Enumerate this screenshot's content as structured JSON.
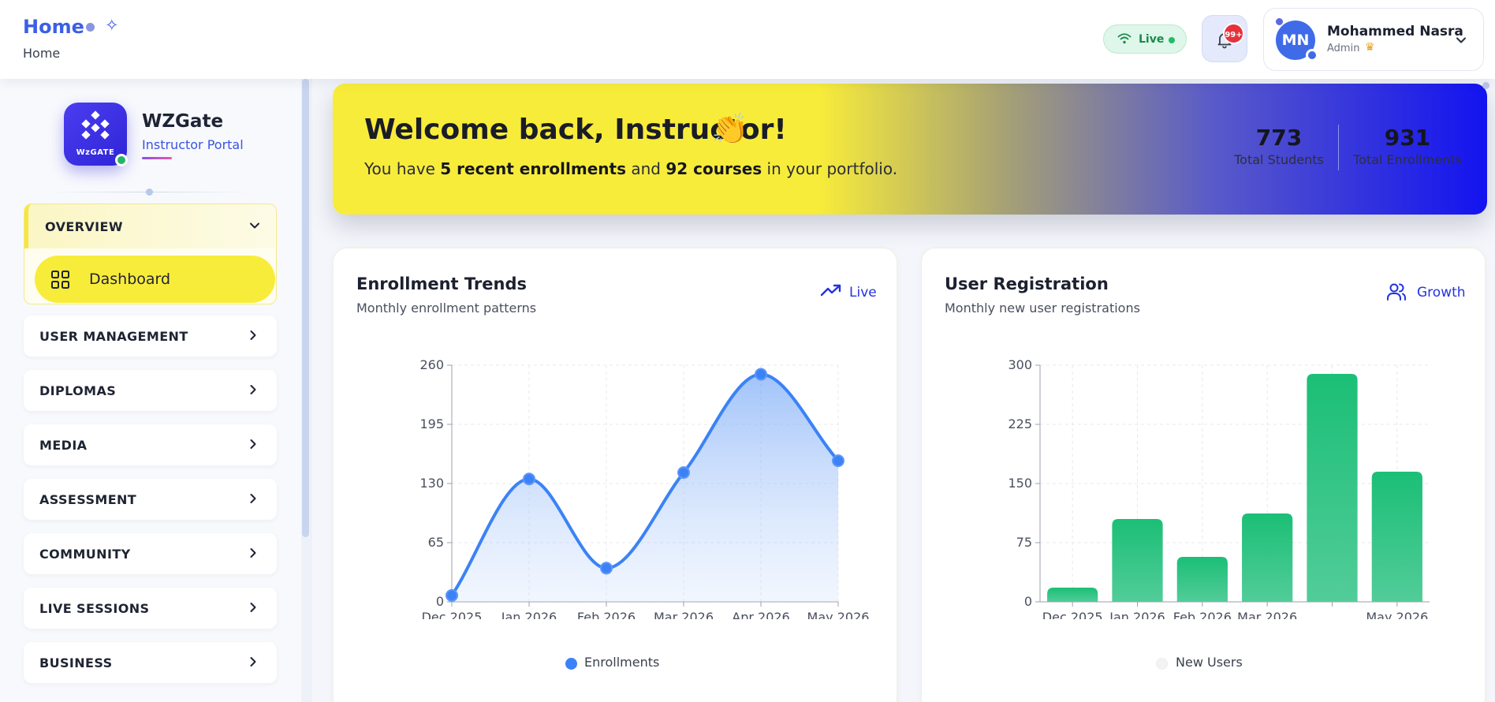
{
  "header": {
    "title": "Home",
    "breadcrumb": "Home",
    "live_label": "Live",
    "notifications_badge": "99+",
    "user": {
      "initials": "MN",
      "name": "Mohammed Nasra",
      "role": "Admin"
    }
  },
  "sidebar": {
    "brand": {
      "logo_text": "WzGATE",
      "name": "WZGate",
      "subtitle": "Instructor Portal"
    },
    "open_section": {
      "label": "OVERVIEW",
      "items": [
        {
          "label": "Dashboard",
          "icon": "grid-icon",
          "active": true
        }
      ]
    },
    "sections": [
      {
        "label": "USER MANAGEMENT"
      },
      {
        "label": "DIPLOMAS"
      },
      {
        "label": "MEDIA"
      },
      {
        "label": "ASSESSMENT"
      },
      {
        "label": "COMMUNITY"
      },
      {
        "label": "LIVE SESSIONS"
      },
      {
        "label": "BUSINESS"
      }
    ]
  },
  "banner": {
    "title": "Welcome back, Instructor!",
    "emoji": "👏",
    "sub_prefix": "You have ",
    "sub_bold_1": "5 recent enrollments",
    "sub_mid": " and ",
    "sub_bold_2": "92 courses",
    "sub_suffix": " in your portfolio.",
    "stats": [
      {
        "value": "773",
        "label": "Total Students"
      },
      {
        "value": "931",
        "label": "Total Enrollments"
      }
    ]
  },
  "cards": {
    "enrollment": {
      "title": "Enrollment Trends",
      "subtitle": "Monthly enrollment patterns",
      "tag": "Live",
      "legend": "Enrollments"
    },
    "registration": {
      "title": "User Registration",
      "subtitle": "Monthly new user registrations",
      "tag": "Growth",
      "legend": "New Users"
    }
  },
  "colors": {
    "accent_yellow": "#f8ec3a",
    "accent_blue": "#3b82f6",
    "bar_green": "#1fbf7a",
    "banner_end": "#1313f0"
  },
  "chart_data": [
    {
      "type": "area",
      "title": "",
      "categories": [
        "Dec 2025",
        "Jan 2026",
        "Feb 2026",
        "Mar 2026",
        "Apr 2026",
        "May 2026"
      ],
      "series": [
        {
          "name": "Enrollments",
          "values": [
            7,
            135,
            37,
            142,
            250,
            155
          ]
        }
      ],
      "y_ticks": [
        0,
        65,
        130,
        195,
        260
      ],
      "ylim": [
        0,
        260
      ],
      "grid": true,
      "legend_position": "bottom",
      "curve": "smooth"
    },
    {
      "type": "bar",
      "title": "",
      "categories": [
        "Dec 2025",
        "Jan 2026",
        "Feb 2026",
        "Mar 2026",
        "",
        "May 2026"
      ],
      "series": [
        {
          "name": "New Users",
          "values": [
            18,
            105,
            57,
            112,
            289,
            165
          ]
        }
      ],
      "y_ticks": [
        0,
        75,
        150,
        225,
        300
      ],
      "ylim": [
        0,
        300
      ],
      "grid": true,
      "legend_position": "bottom"
    }
  ]
}
